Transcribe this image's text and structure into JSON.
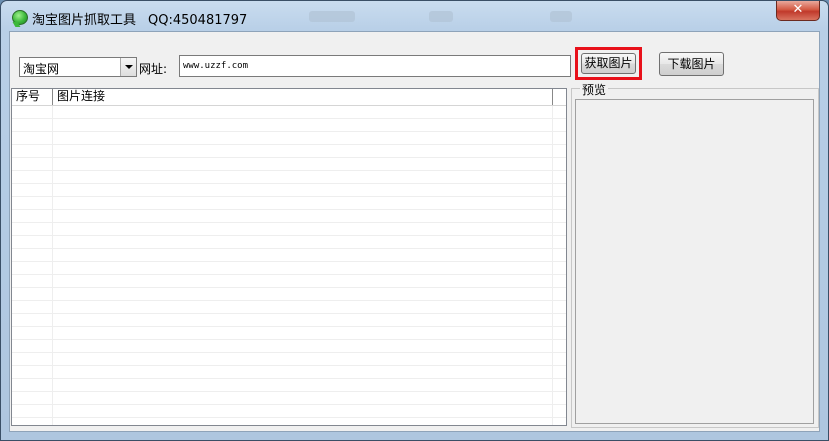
{
  "window": {
    "title": "淘宝图片抓取工具",
    "qq": "QQ:450481797",
    "close_glyph": "✕"
  },
  "toolbar": {
    "site_select_value": "淘宝网",
    "url_label": "网址:",
    "url_value": "www.uzzf.com",
    "fetch_button": "获取图片",
    "download_button": "下载图片"
  },
  "list": {
    "columns": [
      "序号",
      "图片连接"
    ],
    "rows": []
  },
  "preview": {
    "legend": "预览"
  },
  "icons": {
    "app": "app-logo-icon",
    "select_arrow": "chevron-down-icon"
  },
  "colors": {
    "highlight": "#e8101a",
    "close_button": "#c0392b"
  }
}
